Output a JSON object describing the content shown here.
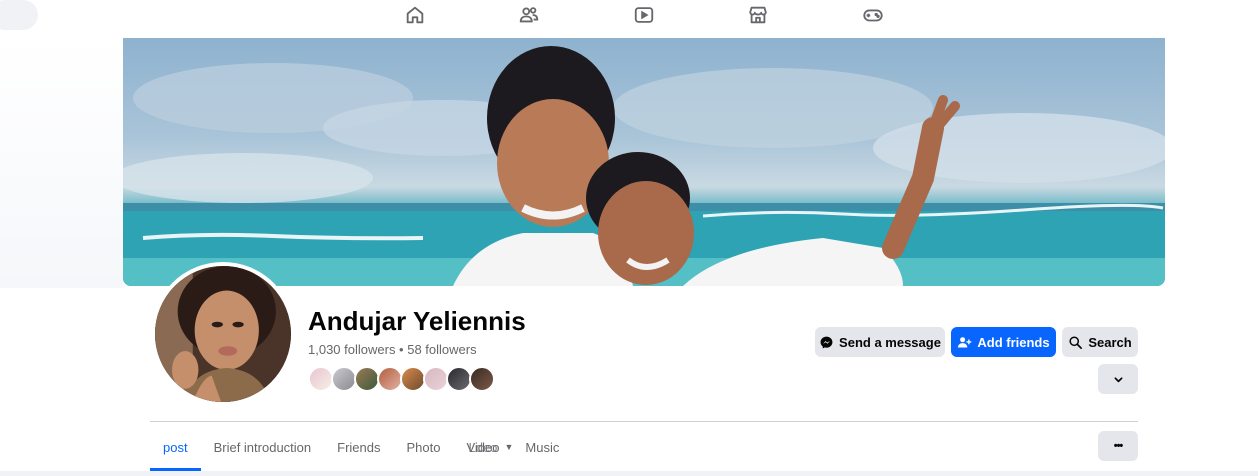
{
  "nav": {
    "icons": [
      "home-icon",
      "friends-icon",
      "video-icon",
      "marketplace-icon",
      "gaming-icon"
    ]
  },
  "profile": {
    "name": "Andujar Yeliennis",
    "followers_text": "1,030 followers • 58 followers",
    "friend_avatars_count": 8
  },
  "actions": {
    "send_message": "Send a message",
    "add_friends": "Add friends",
    "search": "Search"
  },
  "tabs": {
    "post": "post",
    "brief_intro": "Brief introduction",
    "friends": "Friends",
    "photo": "Photo",
    "video_a": "Video",
    "video_b": "Ldeo",
    "music": "Music",
    "more": "•••"
  },
  "colors": {
    "accent": "#0866ff",
    "button_gray": "#e4e6eb",
    "text_secondary": "#65676b"
  }
}
